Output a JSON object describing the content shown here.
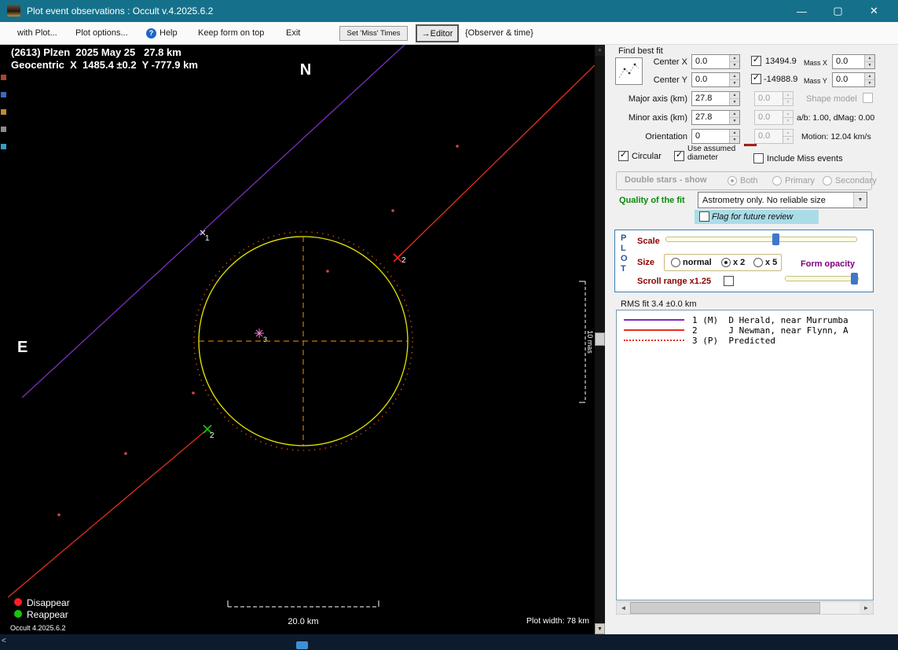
{
  "colors": {
    "titlebar": "#15718b",
    "chord1_miss": "#7b2fbe",
    "chord2_observed": "#e53020",
    "predicted_dotted": "#e53020",
    "asteroid_outline": "#e6e600",
    "crosshair": "#c87800",
    "disappear": "#ff2020",
    "reappear": "#16c60c",
    "quality_label": "#0a8a0a",
    "form_opacity_label": "#800080",
    "flag_highlight": "#aadce8",
    "slider_thumb": "#3f77c9"
  },
  "window": {
    "title": "Plot event observations : Occult v.4.2025.6.2",
    "minimize_glyph": "—",
    "maximize_glyph": "▢",
    "close_glyph": "✕"
  },
  "menubar": {
    "items": [
      "with Plot...",
      "Plot options...",
      "Help",
      "Keep form on top",
      "Exit"
    ],
    "miss_times_button": "Set 'Miss' Times",
    "editor_button": "→Editor",
    "observer_time_label": "{Observer & time}"
  },
  "plot": {
    "header_line1": "(2613) Plzen  2025 May 25   27.8 km",
    "header_line2": "Geocentric  X  1485.4 ±0.2  Y -777.9 km",
    "north_label": "N",
    "east_label": "E",
    "chord1_label": "1",
    "chord2_disappear_label": "2",
    "chord2_reappear_label": "2",
    "chord3_label": "3",
    "mas_bracket_label": "10 mas",
    "scale_bar_label": "20.0 km",
    "plot_width_label": "Plot width: 78 km",
    "version_label": "Occult 4.2025.6.2",
    "legend_disappear": "Disappear",
    "legend_reappear": "Reappear"
  },
  "fit_panel": {
    "find_best_fit_label": "Find best fit",
    "center_x_label": "Center X",
    "center_x_value": "0.0",
    "center_y_label": "Center Y",
    "center_y_value": "0.0",
    "mass_x_coeff": "13494.9",
    "mass_x_label": "Mass X",
    "mass_x_value": "0.0",
    "mass_y_coeff": "-14988.9",
    "mass_y_label": "Mass Y",
    "mass_y_value": "0.0",
    "major_axis_label": "Major axis (km)",
    "major_axis_value": "27.8",
    "major_axis_aux": "0.0",
    "minor_axis_label": "Minor axis (km)",
    "minor_axis_value": "27.8",
    "minor_axis_aux": "0.0",
    "orientation_label": "Orientation",
    "orientation_value": "0",
    "orientation_aux": "0.0",
    "shape_model_label": "Shape model",
    "ab_dmag_label": "a/b: 1.00, dMag: 0.00",
    "motion_label": "Motion: 12.04 km/s",
    "circular_label": "Circular",
    "use_assumed_line1": "Use assumed",
    "use_assumed_line2": "diameter",
    "include_miss_label": "Include Miss events",
    "double_stars_label": "Double stars - show",
    "double_stars_options": [
      "Both",
      "Primary",
      "Secondary"
    ],
    "quality_label": "Quality of the fit",
    "quality_value": "Astrometry only. No reliable size",
    "flag_review_label": "Flag for future review",
    "states": {
      "mass_x_checked": true,
      "mass_y_checked": true,
      "shape_model_checked": false,
      "circular_checked": true,
      "use_assumed_checked": true,
      "include_miss_checked": false,
      "double_both": true,
      "double_primary": false,
      "double_secondary": false,
      "flag_review_checked": false
    }
  },
  "plot_panel": {
    "letters": [
      "P",
      "L",
      "O",
      "T"
    ],
    "scale_label": "Scale",
    "size_label": "Size",
    "size_options": [
      "normal",
      "x 2",
      "x 5"
    ],
    "form_opacity_label": "Form opacity",
    "scroll_range_label": "Scroll range x1.25",
    "states": {
      "size_normal": false,
      "size_x2": true,
      "size_x5": false,
      "scroll_range_checked": false
    }
  },
  "results": {
    "rms_label": "RMS fit 3.4 ±0.0 km",
    "observations": [
      {
        "text": "1 (M)  D Herald, near Murrumba",
        "line_style": "solid-purple"
      },
      {
        "text": "2      J Newman, near Flynn, A",
        "line_style": "solid-red"
      },
      {
        "text": "3 (P)  Predicted",
        "line_style": "dotted-red"
      }
    ]
  }
}
